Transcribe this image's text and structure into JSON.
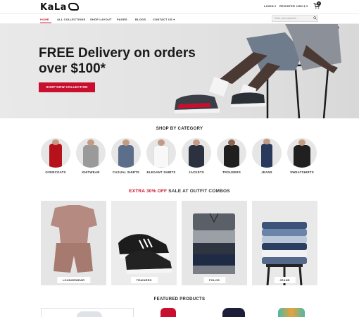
{
  "header": {
    "logo_text": "KaLa",
    "login": "LOGIN ▾",
    "register": "REGISTER",
    "currency": "USD $ ▾",
    "cart_count": "0"
  },
  "nav": {
    "items": [
      {
        "label": "HOME"
      },
      {
        "label": "ALL COLLECTIONS"
      },
      {
        "label": "SHOP LAYOUT"
      },
      {
        "label": "PAGES"
      },
      {
        "label": "BLOGS"
      },
      {
        "label": "CONTACT US ▾"
      }
    ],
    "search_placeholder": "Enter your keyword..."
  },
  "hero": {
    "title": "FREE Delivery on orders over $100*",
    "button": "SHOP NOW COLLECTION"
  },
  "categories": {
    "title": "SHOP BY CATEGORY",
    "items": [
      {
        "label": "OVERCOATS",
        "color": "#b5121b"
      },
      {
        "label": "KNITWEAR",
        "color": "#9a9a9a"
      },
      {
        "label": "CASUAL SHIRTS",
        "color": "#5c6e89"
      },
      {
        "label": "ELEGANT SHIRTS",
        "color": "#f0f0f0"
      },
      {
        "label": "JACKETS",
        "color": "#2c3140"
      },
      {
        "label": "TROUSERS",
        "color": "#1f1f1f"
      },
      {
        "label": "JEANS",
        "color": "#2a3a5c"
      },
      {
        "label": "SWEATSHIRTS",
        "color": "#202020"
      }
    ]
  },
  "promo": {
    "highlight": "EXTRA 30% OFF",
    "rest": "SALE AT OUTFIT COMBOS"
  },
  "combos": [
    {
      "label": "LOUNGEWEAR",
      "bg": "#e5e5e5",
      "item_color": "#b58a80"
    },
    {
      "label": "TRAINERS",
      "bg": "#ececec",
      "item_color": "#1c1c1c"
    },
    {
      "label": "POLOS",
      "bg": "#e6e6e6",
      "item_color": "#4a4f5a"
    },
    {
      "label": "JEANS",
      "bg": "#e9e9e9",
      "item_color": "#55698a"
    }
  ],
  "featured": {
    "title": "FEATURED PRODUCTS"
  },
  "colors": {
    "accent": "#c8102e",
    "text": "#222222"
  }
}
